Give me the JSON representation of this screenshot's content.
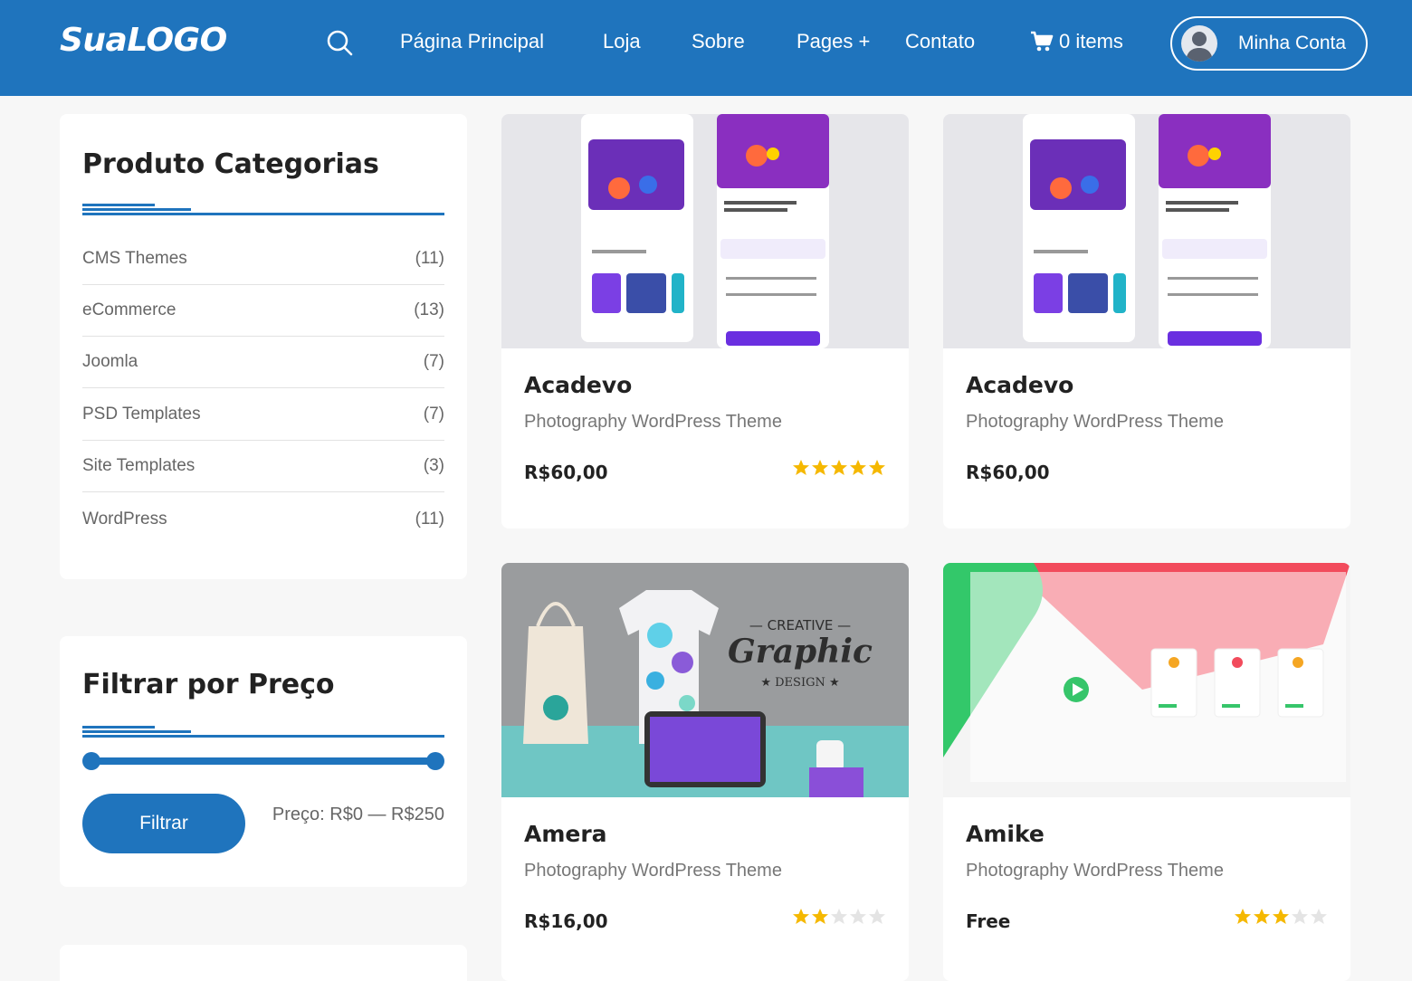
{
  "header": {
    "logo": "SuaLOGO",
    "nav": [
      "Página Principal",
      "Loja",
      "Sobre",
      "Pages +",
      "Contato"
    ],
    "cart_label": "0 items",
    "account_label": "Minha Conta"
  },
  "categories": {
    "title": "Produto Categorias",
    "items": [
      {
        "name": "CMS Themes",
        "count": "(11)"
      },
      {
        "name": "eCommerce",
        "count": "(13)"
      },
      {
        "name": "Joomla",
        "count": "(7)"
      },
      {
        "name": "PSD Templates",
        "count": "(7)"
      },
      {
        "name": "Site Templates",
        "count": "(3)"
      },
      {
        "name": "WordPress",
        "count": "(11)"
      }
    ]
  },
  "price_filter": {
    "title": "Filtrar por Preço",
    "button": "Filtrar",
    "range_text": "Preço: R$0 — R$250",
    "min_fraction": 0,
    "max_fraction": 1
  },
  "products": [
    {
      "title": "Acadevo",
      "subtitle": "Photography WordPress Theme",
      "price": "R$60,00",
      "rating": 5,
      "show_rating": true
    },
    {
      "title": "Acadevo",
      "subtitle": "Photography WordPress Theme",
      "price": "R$60,00",
      "rating": 0,
      "show_rating": false
    },
    {
      "title": "Amera",
      "subtitle": "Photography WordPress Theme",
      "price": "R$16,00",
      "rating": 2,
      "show_rating": true
    },
    {
      "title": "Amike",
      "subtitle": "Photography WordPress Theme",
      "price": "Free",
      "rating": 3,
      "show_rating": true
    }
  ],
  "thumb_texts": {
    "graphic_top": "— CREATIVE —",
    "graphic_main": "Graphic",
    "graphic_design": "★ DESIGN ★"
  },
  "colors": {
    "primary": "#1f74bd",
    "star_filled": "#f5b800",
    "star_empty": "#e4e4e4"
  }
}
